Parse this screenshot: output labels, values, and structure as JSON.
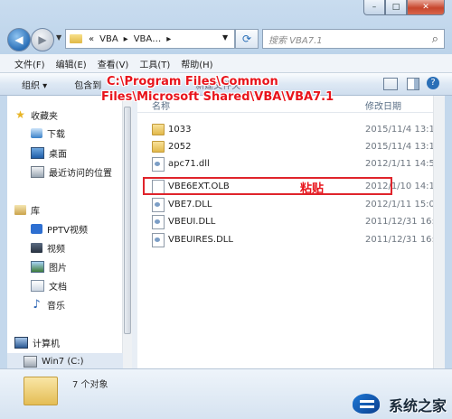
{
  "window": {
    "caption_buttons": [
      "–",
      "□",
      "✕"
    ]
  },
  "address": {
    "crumbs": [
      "«",
      "VBA",
      "▸",
      "VBA…",
      "▸"
    ],
    "refresh_icon": "refresh-icon",
    "search_placeholder": "搜索 VBA7.1",
    "search_icon": "⌕"
  },
  "menu": [
    "文件(F)",
    "编辑(E)",
    "查看(V)",
    "工具(T)",
    "帮助(H)"
  ],
  "toolbar": {
    "organize": "组织 ▾",
    "include": "包含到",
    "newfolder": "新建文件夹"
  },
  "sidebar": {
    "favorites": "收藏夹",
    "downloads": "下载",
    "desktop": "桌面",
    "recent": "最近访问的位置",
    "libraries": "库",
    "pptv": "PPTV视频",
    "videos": "视频",
    "pictures": "图片",
    "documents": "文档",
    "music": "音乐",
    "computer": "计算机",
    "drive": "Win7 (C:)"
  },
  "columns": {
    "name": "名称",
    "date": "修改日期"
  },
  "files": [
    {
      "name": "1033",
      "date": "2015/11/4 13:10",
      "type": "folder"
    },
    {
      "name": "2052",
      "date": "2015/11/4 13:10",
      "type": "folder"
    },
    {
      "name": "apc71.dll",
      "date": "2012/1/11 14:56",
      "type": "dll"
    },
    {
      "name": "VBE6EXT.OLB",
      "date": "2012/1/10 14:17",
      "type": "olb"
    },
    {
      "name": "VBE7.DLL",
      "date": "2012/1/11 15:03",
      "type": "dll"
    },
    {
      "name": "VBEUI.DLL",
      "date": "2011/12/31 16:10",
      "type": "dll"
    },
    {
      "name": "VBEUIRES.DLL",
      "date": "2011/12/31 16:10",
      "type": "dll"
    }
  ],
  "annotation": {
    "path_line1": "C:\\Program Files\\Common",
    "path_line2": "Files\\Microsoft Shared\\VBA\\VBA7.1",
    "paste": "粘贴",
    "box_color": "#e0242b"
  },
  "details": {
    "count": "7 个对象"
  },
  "watermark": {
    "text": "系统之家"
  }
}
